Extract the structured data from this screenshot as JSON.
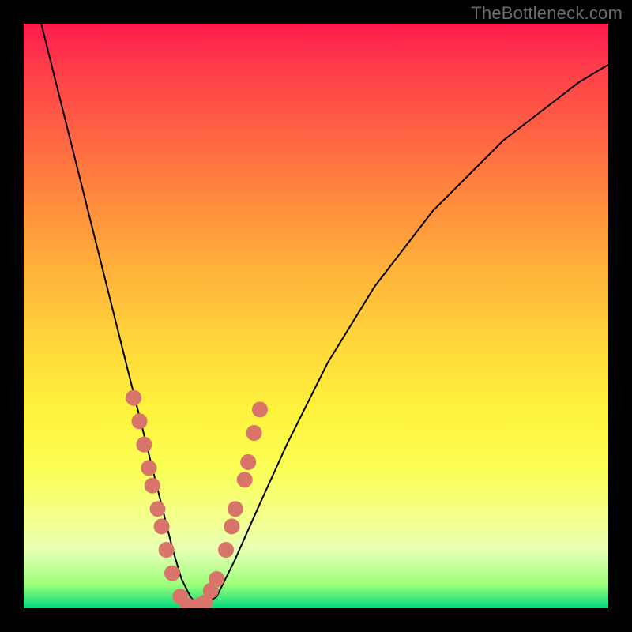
{
  "watermark": "TheBottleneck.com",
  "chart_data": {
    "type": "line",
    "title": "",
    "xlabel": "",
    "ylabel": "",
    "xlim": [
      0,
      100
    ],
    "ylim": [
      0,
      100
    ],
    "series": [
      {
        "name": "bottleneck-curve",
        "x": [
          3,
          6,
          9,
          12,
          15,
          18,
          19.5,
          21,
          22.5,
          24,
          25.5,
          27,
          28.5,
          30,
          33,
          36,
          40,
          45,
          52,
          60,
          70,
          82,
          95,
          100
        ],
        "y": [
          100,
          88,
          76,
          64,
          52,
          40,
          34,
          28,
          22,
          16,
          10,
          5,
          2,
          0,
          2,
          8,
          17,
          28,
          42,
          55,
          68,
          80,
          90,
          93
        ]
      }
    ],
    "markers": {
      "name": "curve-dots",
      "color": "#d8746a",
      "points": [
        {
          "x": 18.8,
          "y": 36
        },
        {
          "x": 19.8,
          "y": 32
        },
        {
          "x": 20.6,
          "y": 28
        },
        {
          "x": 21.4,
          "y": 24
        },
        {
          "x": 22.0,
          "y": 21
        },
        {
          "x": 22.9,
          "y": 17
        },
        {
          "x": 23.6,
          "y": 14
        },
        {
          "x": 24.4,
          "y": 10
        },
        {
          "x": 25.4,
          "y": 6
        },
        {
          "x": 26.8,
          "y": 2
        },
        {
          "x": 28.0,
          "y": 0.5
        },
        {
          "x": 30.0,
          "y": 0.5
        },
        {
          "x": 31.0,
          "y": 1
        },
        {
          "x": 32.0,
          "y": 3
        },
        {
          "x": 33.0,
          "y": 5
        },
        {
          "x": 34.6,
          "y": 10
        },
        {
          "x": 35.6,
          "y": 14
        },
        {
          "x": 36.2,
          "y": 17
        },
        {
          "x": 37.8,
          "y": 22
        },
        {
          "x": 38.4,
          "y": 25
        },
        {
          "x": 39.4,
          "y": 30
        },
        {
          "x": 40.4,
          "y": 34
        }
      ]
    }
  }
}
